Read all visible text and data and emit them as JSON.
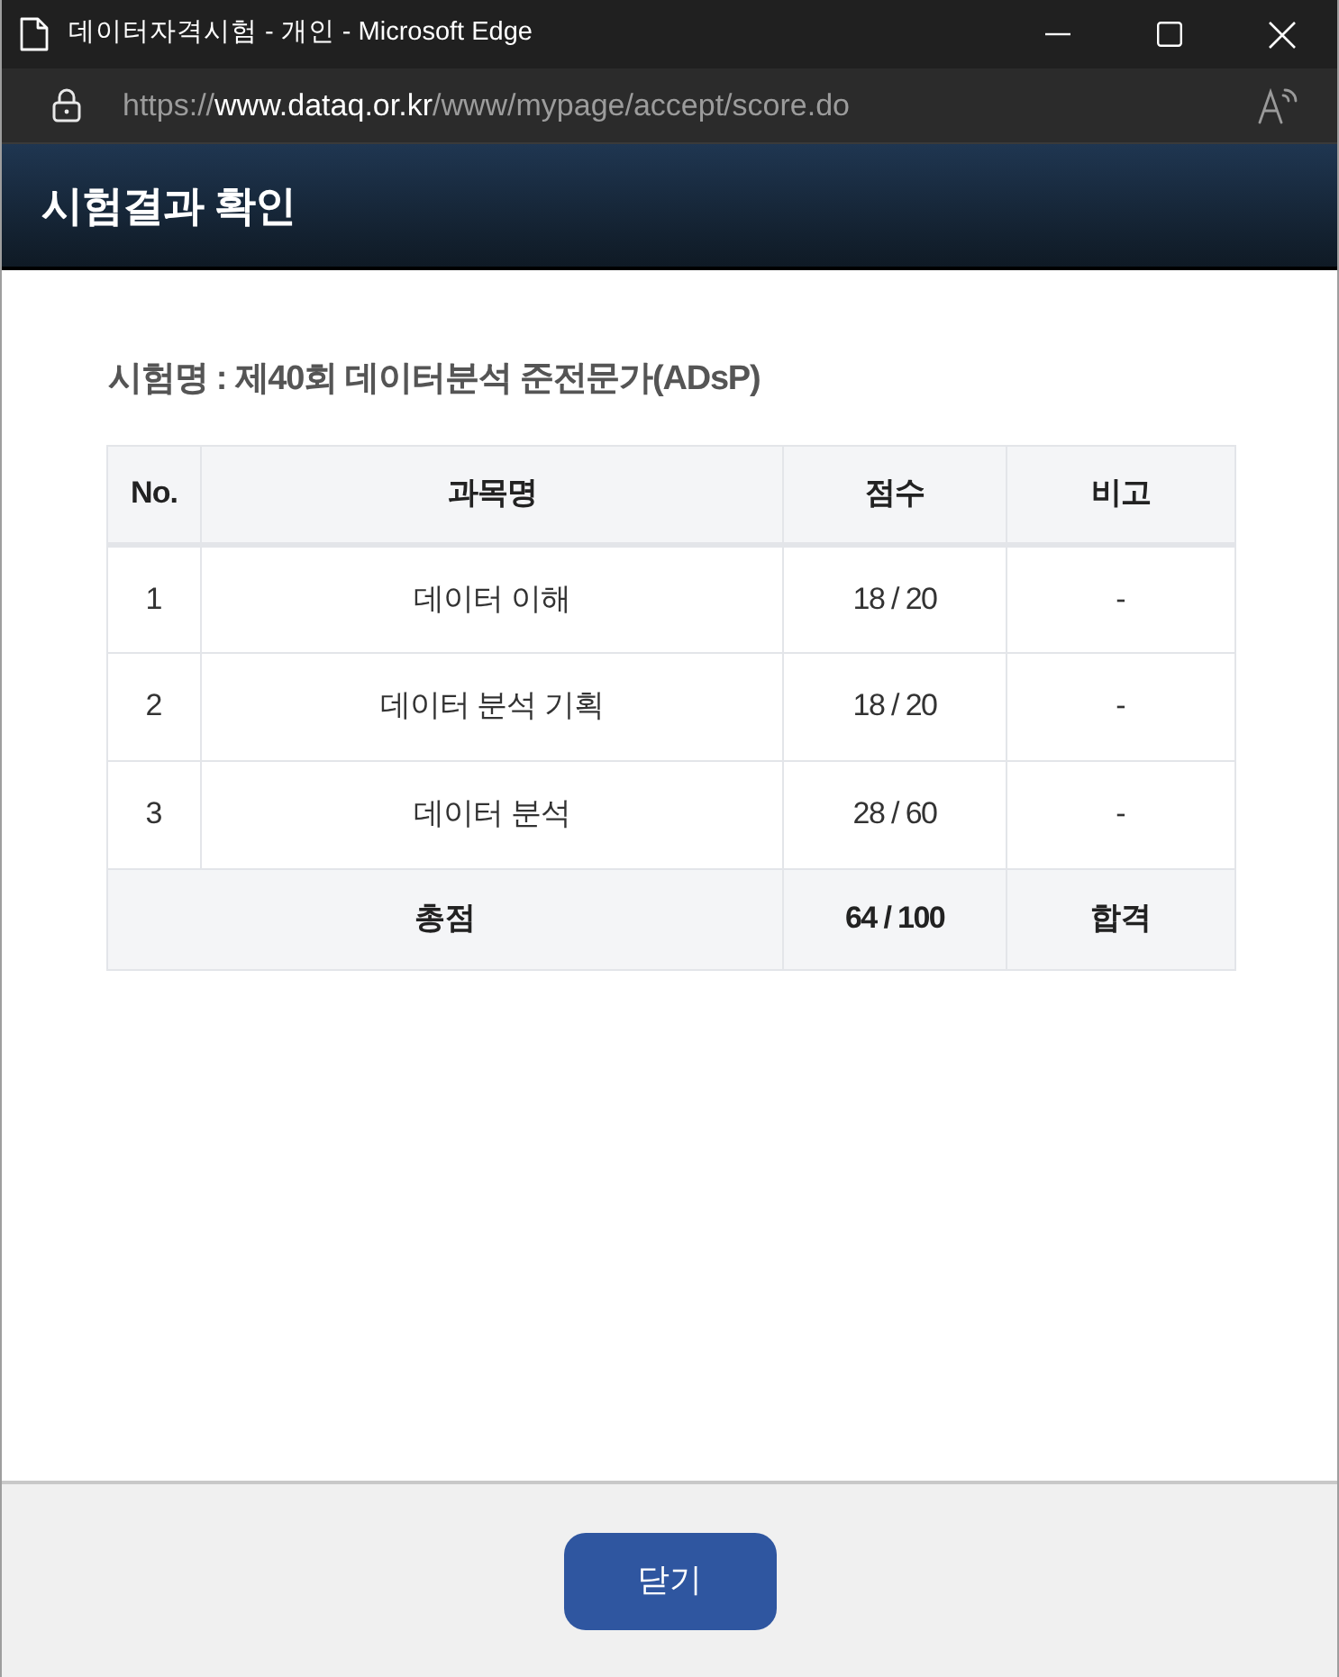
{
  "window": {
    "title": "데이터자격시험 - 개인 - Microsoft Edge"
  },
  "address_bar": {
    "url": {
      "scheme": "https://",
      "host": "www.dataq.or.kr",
      "path": "/www/mypage/accept/score.do"
    }
  },
  "header": {
    "title": "시험결과 확인"
  },
  "exam_name": "시험명 : 제40회 데이터분석 준전문가(ADsP)",
  "table": {
    "columns": [
      "No.",
      "과목명",
      "점수",
      "비고"
    ],
    "rows": [
      {
        "no": "1",
        "subject": "데이터 이해",
        "score": "18 / 20",
        "note": "-"
      },
      {
        "no": "2",
        "subject": "데이터 분석 기획",
        "score": "18 / 20",
        "note": "-"
      },
      {
        "no": "3",
        "subject": "데이터 분석",
        "score": "28 / 60",
        "note": "-"
      }
    ],
    "total": {
      "label": "총점",
      "score": "64 / 100",
      "result": "합격"
    }
  },
  "buttons": [
    "닫기"
  ]
}
